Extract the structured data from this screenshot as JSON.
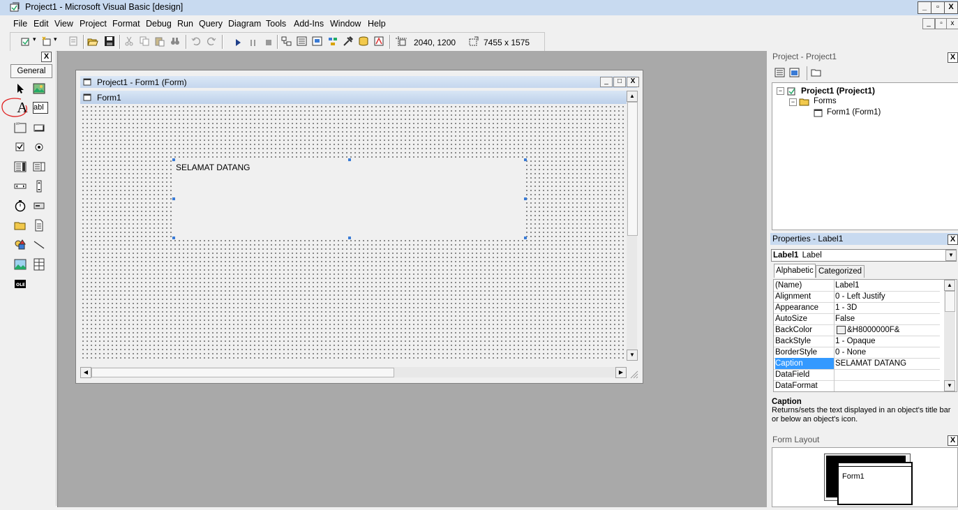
{
  "window": {
    "title": "Project1 - Microsoft Visual Basic [design]",
    "controls": [
      "_",
      "▫",
      "X"
    ]
  },
  "menu": [
    "File",
    "Edit",
    "View",
    "Project",
    "Format",
    "Debug",
    "Run",
    "Query",
    "Diagram",
    "Tools",
    "Add-Ins",
    "Window",
    "Help"
  ],
  "toolbar": {
    "position_readout": "2040, 1200",
    "size_readout": "7455 x 1575"
  },
  "toolbox": {
    "header": "General",
    "close": "X",
    "label_tool": "A",
    "textbox_tool": "abl"
  },
  "form_window": {
    "title": "Project1 - Form1 (Form)",
    "form_caption": "Form1",
    "label_caption": "SELAMAT DATANG"
  },
  "project_panel": {
    "title": "Project - Project1",
    "tree": {
      "project": "Project1 (Project1)",
      "folder": "Forms",
      "form": "Form1 (Form1)"
    }
  },
  "properties_panel": {
    "title": "Properties - Label1",
    "object_name": "Label1",
    "object_type": "Label",
    "tabs": [
      "Alphabetic",
      "Categorized"
    ],
    "rows": [
      {
        "name": "(Name)",
        "value": "Label1"
      },
      {
        "name": "Alignment",
        "value": "0 - Left Justify"
      },
      {
        "name": "Appearance",
        "value": "1 - 3D"
      },
      {
        "name": "AutoSize",
        "value": "False"
      },
      {
        "name": "BackColor",
        "value": "&H8000000F&"
      },
      {
        "name": "BackStyle",
        "value": "1 - Opaque"
      },
      {
        "name": "BorderStyle",
        "value": "0 - None"
      },
      {
        "name": "Caption",
        "value": "SELAMAT DATANG"
      },
      {
        "name": "DataField",
        "value": ""
      },
      {
        "name": "DataFormat",
        "value": ""
      }
    ],
    "description_title": "Caption",
    "description_text": "Returns/sets the text displayed in an object's title bar or below an object's icon."
  },
  "form_layout_panel": {
    "title": "Form Layout",
    "form_label": "Form1"
  },
  "colors": {
    "titlebar": "#c8daf0",
    "selection": "#3399ff",
    "mdi_background": "#a9a9a9",
    "annotation": "#e02020"
  }
}
